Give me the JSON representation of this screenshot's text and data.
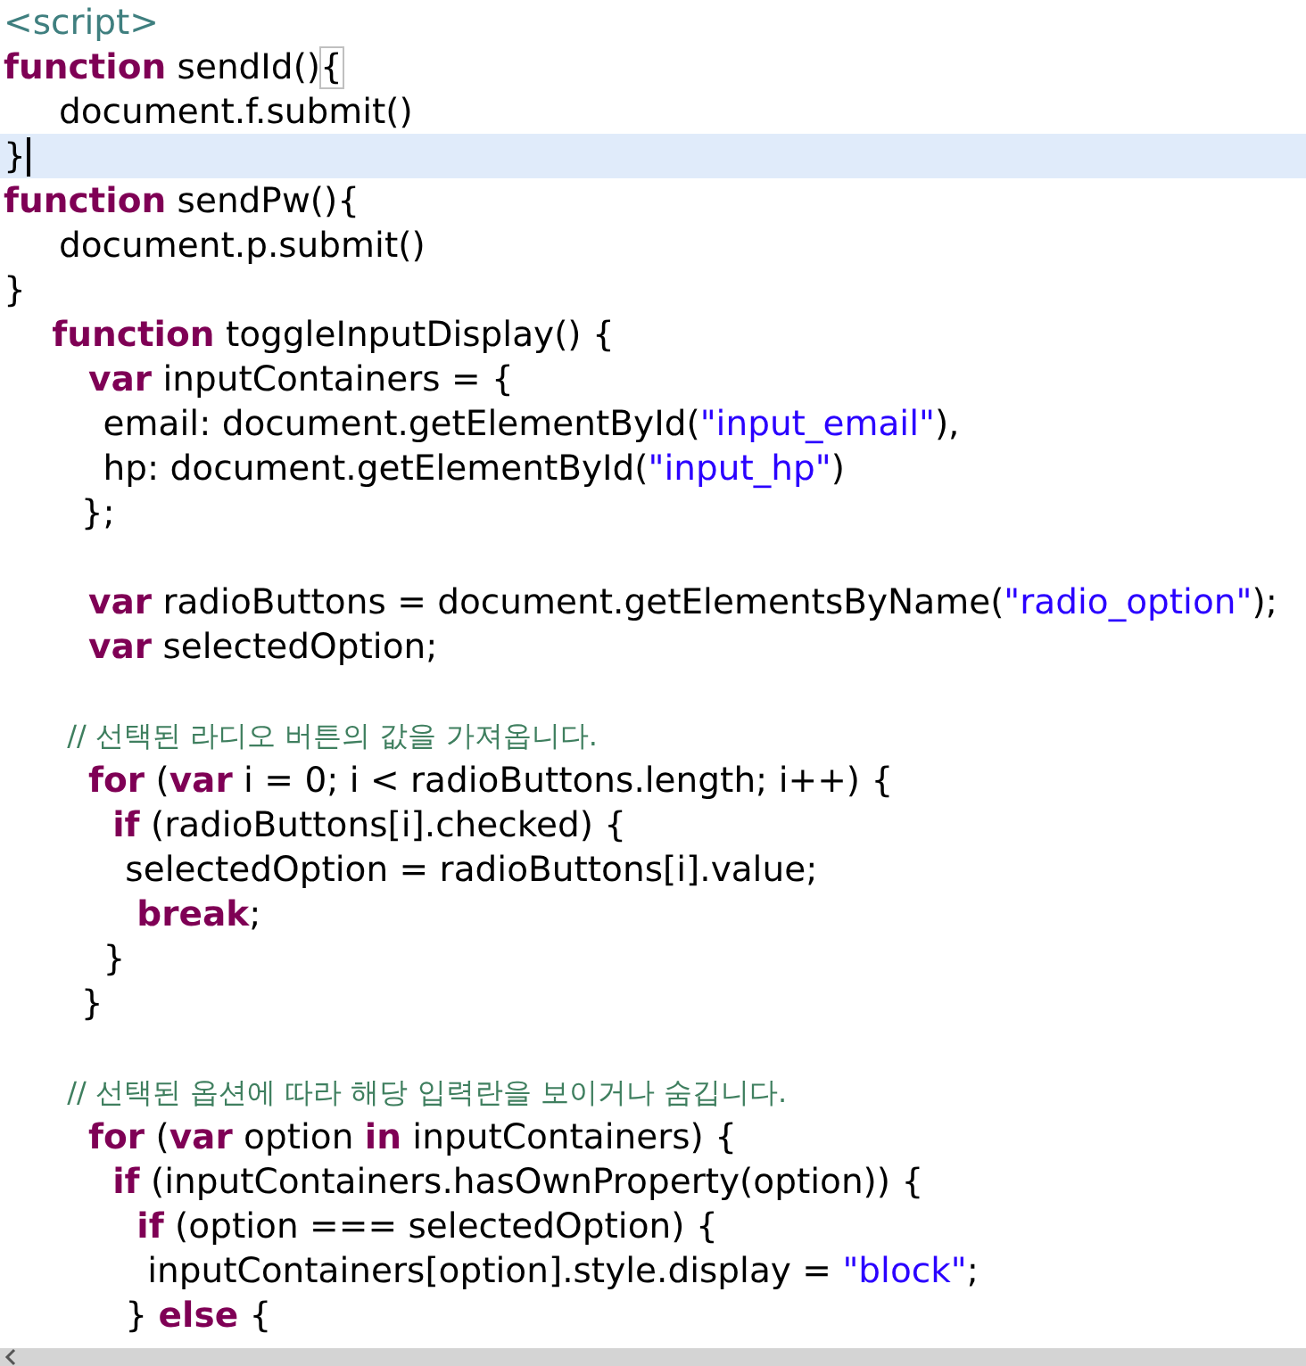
{
  "editor": {
    "lines": [
      {
        "kind": "code",
        "current": false,
        "tokens": [
          {
            "kind": "tag",
            "text": "<script>"
          }
        ]
      },
      {
        "kind": "code",
        "current": false,
        "tokens": [
          {
            "kind": "keyword",
            "text": "function"
          },
          {
            "kind": "plain",
            "text": " sendId()"
          },
          {
            "kind": "plain",
            "text": "{",
            "matched": true
          }
        ]
      },
      {
        "kind": "code",
        "current": false,
        "tokens": [
          {
            "kind": "plain",
            "text": "     document.f.submit()"
          }
        ]
      },
      {
        "kind": "code",
        "current": true,
        "tokens": [
          {
            "kind": "plain",
            "text": "}"
          }
        ]
      },
      {
        "kind": "code",
        "current": false,
        "tokens": [
          {
            "kind": "keyword",
            "text": "function"
          },
          {
            "kind": "plain",
            "text": " sendPw(){"
          }
        ]
      },
      {
        "kind": "code",
        "current": false,
        "tokens": [
          {
            "kind": "plain",
            "text": "     document.p.submit()"
          }
        ]
      },
      {
        "kind": "code",
        "current": false,
        "tokens": [
          {
            "kind": "plain",
            "text": "}"
          }
        ]
      },
      {
        "kind": "code",
        "current": false,
        "tokens": [
          {
            "kind": "keyword",
            "text": "    function"
          },
          {
            "kind": "plain",
            "text": " toggleInputDisplay() {"
          }
        ]
      },
      {
        "kind": "code",
        "current": false,
        "tokens": [
          {
            "kind": "keyword",
            "text": "       var"
          },
          {
            "kind": "plain",
            "text": " inputContainers = {"
          }
        ]
      },
      {
        "kind": "code",
        "current": false,
        "tokens": [
          {
            "kind": "plain",
            "text": "         email: document.getElementById("
          },
          {
            "kind": "string",
            "text": "\"input_email\""
          },
          {
            "kind": "plain",
            "text": "),"
          }
        ]
      },
      {
        "kind": "code",
        "current": false,
        "tokens": [
          {
            "kind": "plain",
            "text": "         hp: document.getElementById("
          },
          {
            "kind": "string",
            "text": "\"input_hp\""
          },
          {
            "kind": "plain",
            "text": ")"
          }
        ]
      },
      {
        "kind": "code",
        "current": false,
        "tokens": [
          {
            "kind": "plain",
            "text": "       };"
          }
        ]
      },
      {
        "kind": "blank"
      },
      {
        "kind": "code",
        "current": false,
        "tokens": [
          {
            "kind": "keyword",
            "text": "       var"
          },
          {
            "kind": "plain",
            "text": " radioButtons = document.getElementsByName("
          },
          {
            "kind": "string",
            "text": "\"radio_option\""
          },
          {
            "kind": "plain",
            "text": ");"
          }
        ]
      },
      {
        "kind": "code",
        "current": false,
        "tokens": [
          {
            "kind": "keyword",
            "text": "       var"
          },
          {
            "kind": "plain",
            "text": " selectedOption;"
          }
        ]
      },
      {
        "kind": "blank"
      },
      {
        "kind": "code",
        "current": false,
        "tokens": [
          {
            "kind": "comment",
            "text": "       // 선택된 라디오 버튼의 값을 가져옵니다."
          }
        ]
      },
      {
        "kind": "code",
        "current": false,
        "tokens": [
          {
            "kind": "keyword",
            "text": "       for"
          },
          {
            "kind": "plain",
            "text": " ("
          },
          {
            "kind": "keyword",
            "text": "var"
          },
          {
            "kind": "plain",
            "text": " i = 0; i < radioButtons.length; i++) {"
          }
        ]
      },
      {
        "kind": "code",
        "current": false,
        "tokens": [
          {
            "kind": "keyword",
            "text": "         if"
          },
          {
            "kind": "plain",
            "text": " (radioButtons[i].checked) {"
          }
        ]
      },
      {
        "kind": "code",
        "current": false,
        "tokens": [
          {
            "kind": "plain",
            "text": "           selectedOption = radioButtons[i].value;"
          }
        ]
      },
      {
        "kind": "code",
        "current": false,
        "tokens": [
          {
            "kind": "keyword",
            "text": "           break"
          },
          {
            "kind": "plain",
            "text": ";"
          }
        ]
      },
      {
        "kind": "code",
        "current": false,
        "tokens": [
          {
            "kind": "plain",
            "text": "         }"
          }
        ]
      },
      {
        "kind": "code",
        "current": false,
        "tokens": [
          {
            "kind": "plain",
            "text": "       }"
          }
        ]
      },
      {
        "kind": "blank"
      },
      {
        "kind": "code",
        "current": false,
        "tokens": [
          {
            "kind": "comment",
            "text": "       // 선택된 옵션에 따라 해당 입력란을 보이거나 숨깁니다."
          }
        ]
      },
      {
        "kind": "code",
        "current": false,
        "tokens": [
          {
            "kind": "keyword",
            "text": "       for"
          },
          {
            "kind": "plain",
            "text": " ("
          },
          {
            "kind": "keyword",
            "text": "var"
          },
          {
            "kind": "plain",
            "text": " option "
          },
          {
            "kind": "keyword",
            "text": "in"
          },
          {
            "kind": "plain",
            "text": " inputContainers) {"
          }
        ]
      },
      {
        "kind": "code",
        "current": false,
        "tokens": [
          {
            "kind": "keyword",
            "text": "         if"
          },
          {
            "kind": "plain",
            "text": " (inputContainers.hasOwnProperty(option)) {"
          }
        ]
      },
      {
        "kind": "code",
        "current": false,
        "tokens": [
          {
            "kind": "keyword",
            "text": "           if"
          },
          {
            "kind": "plain",
            "text": " (option === selectedOption) {"
          }
        ]
      },
      {
        "kind": "code",
        "current": false,
        "tokens": [
          {
            "kind": "plain",
            "text": "             inputContainers[option].style.display = "
          },
          {
            "kind": "string",
            "text": "\"block\""
          },
          {
            "kind": "plain",
            "text": ";"
          }
        ]
      },
      {
        "kind": "code",
        "current": false,
        "tokens": [
          {
            "kind": "plain",
            "text": "           } "
          },
          {
            "kind": "keyword",
            "text": "else"
          },
          {
            "kind": "plain",
            "text": " {"
          }
        ]
      }
    ]
  }
}
